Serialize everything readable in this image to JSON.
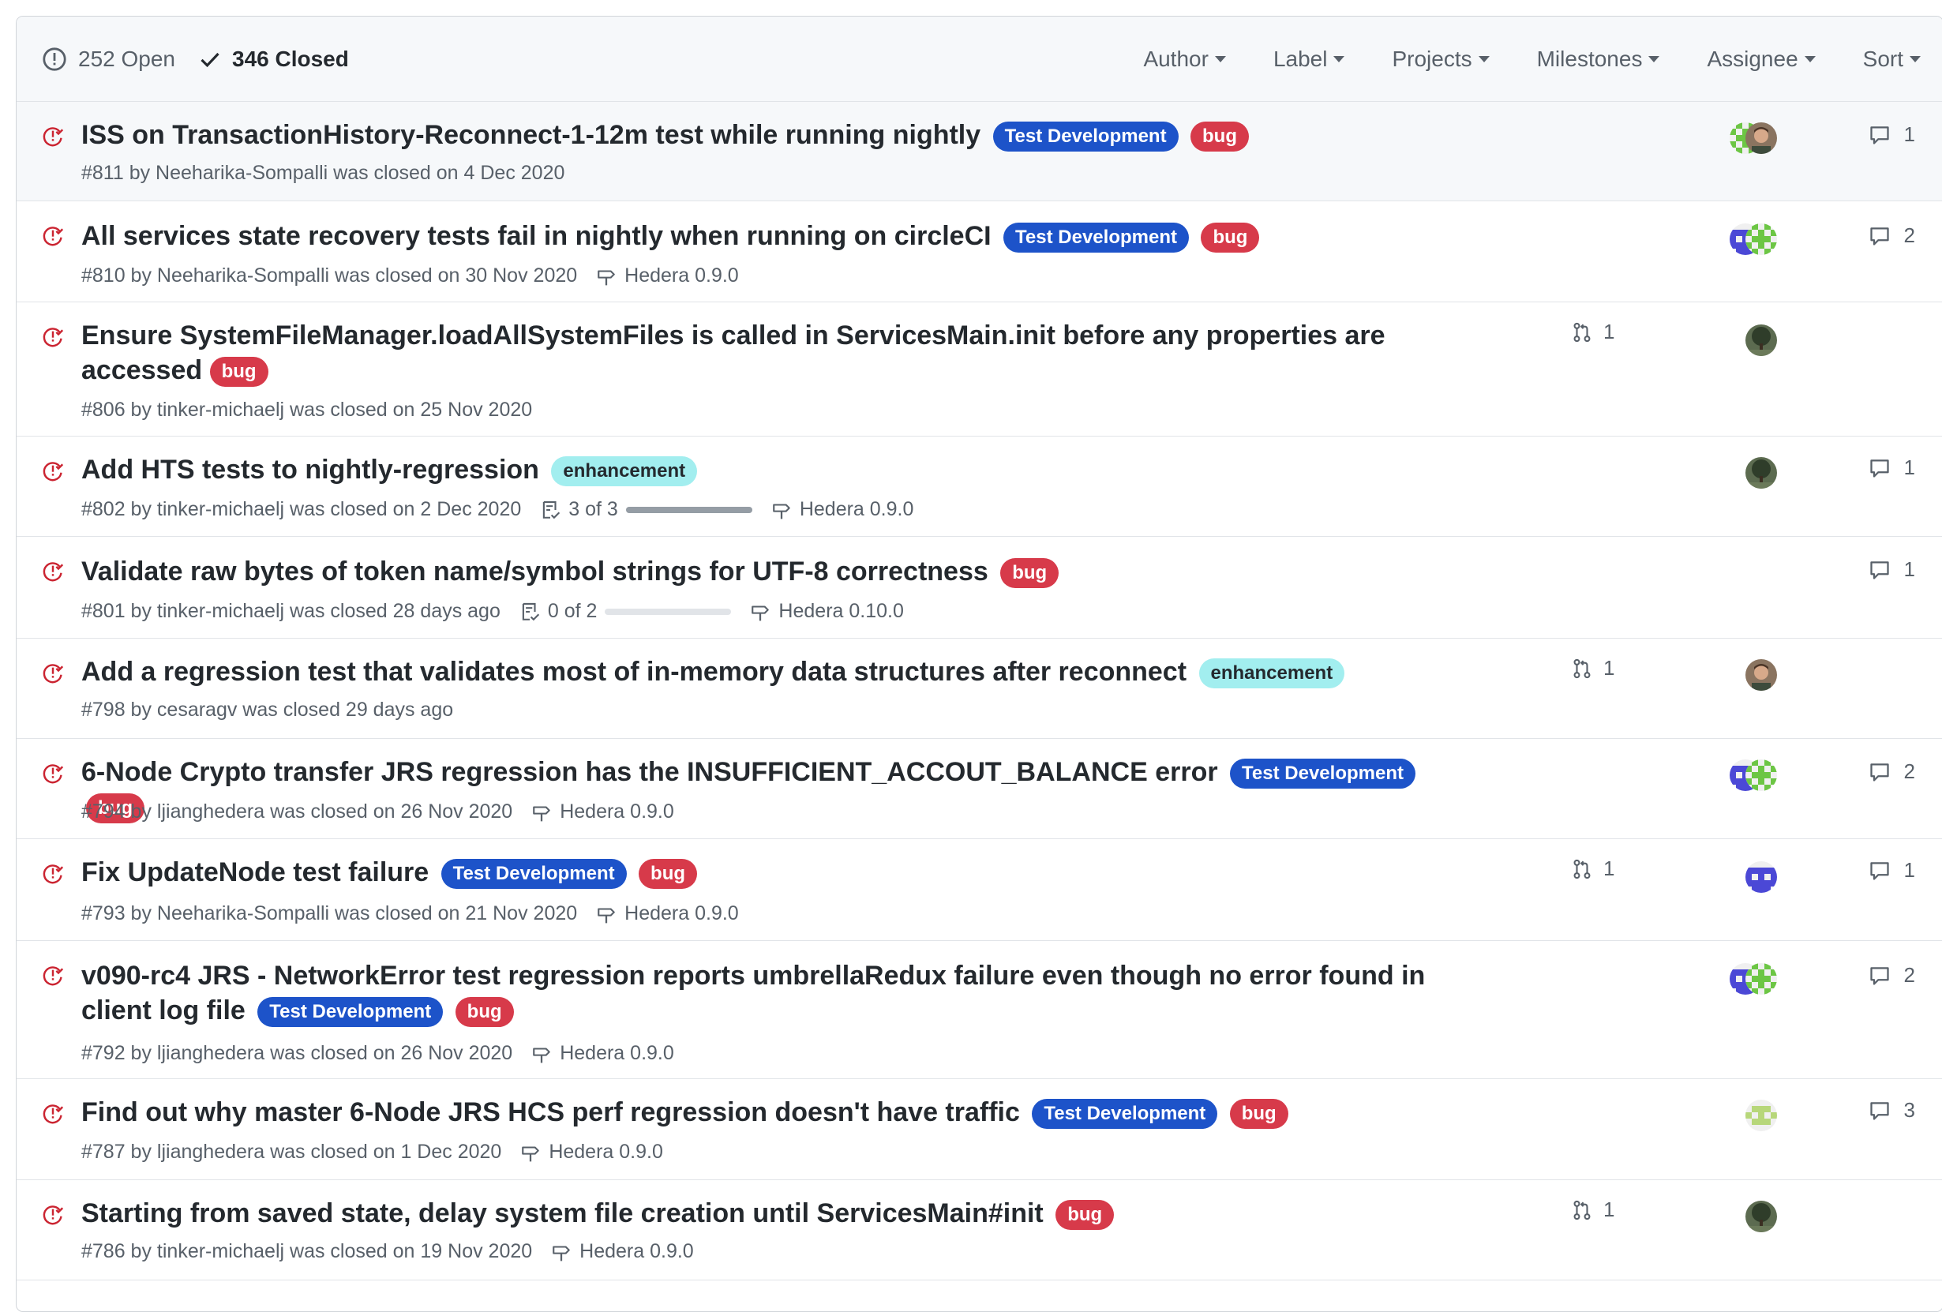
{
  "header": {
    "open_label": "252 Open",
    "closed_label": "346 Closed",
    "filters": [
      "Author",
      "Label",
      "Projects",
      "Milestones",
      "Assignee",
      "Sort"
    ]
  },
  "colors": {
    "closed_red": "#cb2431",
    "test_development": "#1d53c9",
    "bug": "#d73a4a",
    "enhancement": "#a2eeef"
  },
  "issues": [
    {
      "title": "ISS on TransactionHistory-Reconnect-1-12m test while running nightly",
      "labels": [
        "Test Development",
        "bug"
      ],
      "meta": "#811 by Neeharika-Sompalli was closed on 4 Dec 2020",
      "comments": "1"
    },
    {
      "title": "All services state recovery tests fail in nightly when running on circleCI",
      "labels": [
        "Test Development",
        "bug"
      ],
      "meta": "#810 by Neeharika-Sompalli was closed on 30 Nov 2020",
      "milestone": "Hedera 0.9.0",
      "comments": "2"
    },
    {
      "title": "Ensure SystemFileManager.loadAllSystemFiles is called in ServicesMain.init before any properties are accessed",
      "labels": [
        "bug"
      ],
      "meta": "#806 by tinker-michaelj was closed on 25 Nov 2020",
      "linked_prs": "1"
    },
    {
      "title": "Add HTS tests to nightly-regression",
      "labels": [
        "enhancement"
      ],
      "meta": "#802 by tinker-michaelj was closed on 2 Dec 2020",
      "tasks": "3 of 3",
      "task_progress": 1.0,
      "milestone": "Hedera 0.9.0",
      "comments": "1"
    },
    {
      "title": "Validate raw bytes of token name/symbol strings for UTF-8 correctness",
      "labels": [
        "bug"
      ],
      "meta": "#801 by tinker-michaelj was closed 28 days ago",
      "tasks": "0 of 2",
      "task_progress": 0.0,
      "milestone": "Hedera 0.10.0",
      "comments": "1"
    },
    {
      "title": "Add a regression test that validates most of in-memory data structures after reconnect",
      "labels": [
        "enhancement"
      ],
      "meta": "#798 by cesaragv was closed 29 days ago",
      "linked_prs": "1"
    },
    {
      "title": "6-Node Crypto transfer JRS regression has the INSUFFICIENT_ACCOUT_BALANCE error",
      "labels": [
        "Test Development",
        "bug"
      ],
      "meta": "#794 by ljianghedera was closed on 26 Nov 2020",
      "milestone": "Hedera 0.9.0",
      "comments": "2"
    },
    {
      "title": "Fix UpdateNode test failure",
      "labels": [
        "Test Development",
        "bug"
      ],
      "meta": "#793 by Neeharika-Sompalli was closed on 21 Nov 2020",
      "milestone": "Hedera 0.9.0",
      "linked_prs": "1",
      "comments": "1"
    },
    {
      "title": "v090-rc4 JRS - NetworkError test regression reports umbrellaRedux failure even though no error found in client log file",
      "labels": [
        "Test Development",
        "bug"
      ],
      "meta": "#792 by ljianghedera was closed on 26 Nov 2020",
      "milestone": "Hedera 0.9.0",
      "comments": "2"
    },
    {
      "title": "Find out why master 6-Node JRS HCS perf regression doesn't have traffic",
      "labels": [
        "Test Development",
        "bug"
      ],
      "meta": "#787 by ljianghedera was closed on 1 Dec 2020",
      "milestone": "Hedera 0.9.0",
      "comments": "3"
    },
    {
      "title": "Starting from saved state, delay system file creation until ServicesMain#init",
      "labels": [
        "bug"
      ],
      "meta": "#786 by tinker-michaelj was closed on 19 Nov 2020",
      "milestone": "Hedera 0.9.0",
      "linked_prs": "1"
    }
  ]
}
